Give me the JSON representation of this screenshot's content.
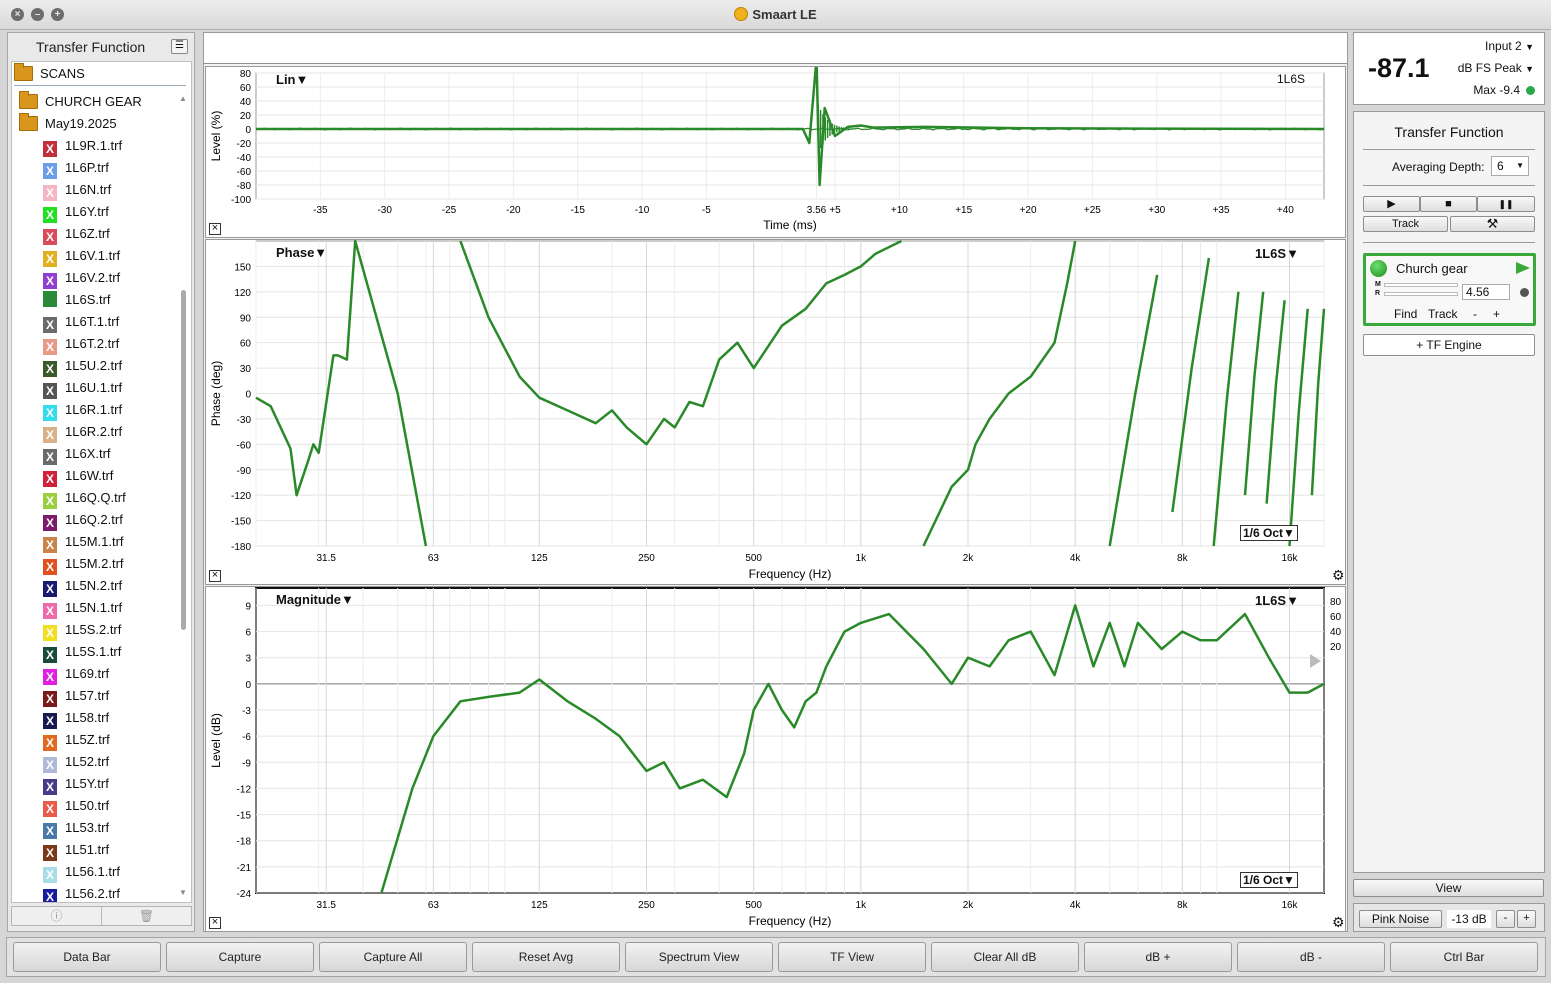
{
  "window": {
    "title": "Smaart LE"
  },
  "left_panel": {
    "title": "Transfer Function",
    "scans_label": "SCANS",
    "folders": [
      "CHURCH GEAR",
      "May19.2025"
    ],
    "files": [
      {
        "name": "1L9R.1.trf",
        "color": "#c0303a"
      },
      {
        "name": "1L6P.trf",
        "color": "#6a9ee8"
      },
      {
        "name": "1L6N.trf",
        "color": "#f4b6c4"
      },
      {
        "name": "1L6Y.trf",
        "color": "#22e022"
      },
      {
        "name": "1L6Z.trf",
        "color": "#d94a5a"
      },
      {
        "name": "1L6V.1.trf",
        "color": "#e0b020"
      },
      {
        "name": "1L6V.2.trf",
        "color": "#9040d0"
      },
      {
        "name": "1L6S.trf",
        "color": "#2a8a3a"
      },
      {
        "name": "1L6T.1.trf",
        "color": "#6a6a6a"
      },
      {
        "name": "1L6T.2.trf",
        "color": "#e89a88"
      },
      {
        "name": "1L5U.2.trf",
        "color": "#3a5a2a"
      },
      {
        "name": "1L6U.1.trf",
        "color": "#555555"
      },
      {
        "name": "1L6R.1.trf",
        "color": "#33ddee"
      },
      {
        "name": "1L6R.2.trf",
        "color": "#d8b08a"
      },
      {
        "name": "1L6X.trf",
        "color": "#6a6a6a"
      },
      {
        "name": "1L6W.trf",
        "color": "#d0203a"
      },
      {
        "name": "1L6Q.Q.trf",
        "color": "#9ad040"
      },
      {
        "name": "1L6Q.2.trf",
        "color": "#7a1a6a"
      },
      {
        "name": "1L5M.1.trf",
        "color": "#c8844a"
      },
      {
        "name": "1L5M.2.trf",
        "color": "#e05020"
      },
      {
        "name": "1L5N.2.trf",
        "color": "#1a1a70"
      },
      {
        "name": "1L5N.1.trf",
        "color": "#ee6aa8"
      },
      {
        "name": "1L5S.2.trf",
        "color": "#f0e020"
      },
      {
        "name": "1L5S.1.trf",
        "color": "#1a4a3a"
      },
      {
        "name": "1L69.trf",
        "color": "#e020e0"
      },
      {
        "name": "1L57.trf",
        "color": "#7a1a1a"
      },
      {
        "name": "1L58.trf",
        "color": "#1a1a50"
      },
      {
        "name": "1L5Z.trf",
        "color": "#e06a20"
      },
      {
        "name": "1L52.trf",
        "color": "#b0b8d8"
      },
      {
        "name": "1L5Y.trf",
        "color": "#4a3a8a"
      },
      {
        "name": "1L50.trf",
        "color": "#e85a4a"
      },
      {
        "name": "1L53.trf",
        "color": "#4a78a8"
      },
      {
        "name": "1L51.trf",
        "color": "#7a3a1a"
      },
      {
        "name": "1L56.1.trf",
        "color": "#a8dde8"
      },
      {
        "name": "1L56.2.trf",
        "color": "#1a1aa0"
      }
    ]
  },
  "impulse_plot": {
    "mode_label": "Lin▼",
    "trace_label": "1L6S",
    "ylabel": "Level (%)",
    "xlabel": "Time (ms)",
    "yticks": [
      "80",
      "60",
      "40",
      "20",
      "0",
      "-20",
      "-40",
      "-60",
      "-80",
      "-100"
    ],
    "xticks": [
      "-35",
      "-30",
      "-25",
      "-20",
      "-15",
      "-10",
      "-5",
      "3.56",
      "+5",
      "+10",
      "+15",
      "+20",
      "+25",
      "+30",
      "+35",
      "+40"
    ]
  },
  "phase_plot": {
    "mode_label": "Phase▼",
    "trace_label": "1L6S▼",
    "smoothing": "1/6 Oct▼",
    "ylabel": "Phase (deg)",
    "xlabel": "Frequency (Hz)",
    "yticks": [
      "150",
      "120",
      "90",
      "60",
      "30",
      "0",
      "-30",
      "-60",
      "-90",
      "-120",
      "-150",
      "-180"
    ],
    "xticks": [
      "31.5",
      "63",
      "125",
      "250",
      "500",
      "1k",
      "2k",
      "4k",
      "8k",
      "16k"
    ]
  },
  "magnitude_plot": {
    "mode_label": "Magnitude▼",
    "trace_label": "1L6S▼",
    "smoothing": "1/6 Oct▼",
    "ylabel": "Level (dB)",
    "xlabel": "Frequency (Hz)",
    "yticks": [
      "9",
      "6",
      "3",
      "0",
      "-3",
      "-6",
      "-9",
      "-12",
      "-15",
      "-18",
      "-21",
      "-24"
    ],
    "coherence_ticks": [
      "80",
      "60",
      "40",
      "20"
    ],
    "xticks": [
      "31.5",
      "63",
      "125",
      "250",
      "500",
      "1k",
      "2k",
      "4k",
      "8k",
      "16k"
    ]
  },
  "meter": {
    "value": "-87.1",
    "input": "Input 2",
    "unit": "dB FS Peak",
    "max": "Max -9.4"
  },
  "tf_panel": {
    "title": "Transfer Function",
    "averaging_label": "Averaging Depth:",
    "averaging_value": "6",
    "play_icon": "▶",
    "stop_icon": "■",
    "pause_icon": "❚❚",
    "track_label": "Track",
    "tools_icon": "⚒",
    "engine": {
      "name": "Church gear",
      "delay": "4.56",
      "m_label": "M",
      "r_label": "R",
      "find": "Find",
      "track": "Track",
      "minus": "-",
      "plus": "+"
    },
    "add_engine": "+ TF Engine",
    "view_label": "View",
    "pink_noise": "Pink Noise",
    "noise_level": "-13 dB",
    "noise_minus": "-",
    "noise_plus": "+"
  },
  "bottom_bar": {
    "buttons": [
      "Data Bar",
      "Capture",
      "Capture All",
      "Reset Avg",
      "Spectrum View",
      "TF View",
      "Clear All dB",
      "dB +",
      "dB -",
      "Ctrl Bar"
    ]
  },
  "colors": {
    "trace": "#2a8a2a",
    "accent": "#3aa83a"
  },
  "chart_data": [
    {
      "type": "line",
      "title": "Lin",
      "xlabel": "Time (ms)",
      "ylabel": "Level (%)",
      "ylim": [
        -100,
        80
      ],
      "xlim": [
        -40,
        43
      ],
      "series": [
        {
          "name": "1L6S",
          "x": [
            -40,
            2.5,
            3.0,
            3.56,
            3.8,
            4.2,
            5,
            6,
            7,
            8,
            12,
            20,
            43
          ],
          "y": [
            0,
            0,
            -20,
            100,
            -80,
            30,
            -10,
            3,
            5,
            2,
            3,
            1,
            0
          ]
        }
      ]
    },
    {
      "type": "line",
      "title": "Phase",
      "xlabel": "Frequency (Hz)",
      "ylabel": "Phase (deg)",
      "ylim": [
        -180,
        180
      ],
      "grid": true,
      "series": [
        {
          "name": "1L6S",
          "x": [
            20,
            22,
            25,
            26,
            28,
            29,
            30,
            33,
            34,
            36,
            38,
            50,
            60,
            75,
            90,
            110,
            125,
            150,
            180,
            200,
            220,
            250,
            280,
            300,
            330,
            360,
            400,
            450,
            500,
            600,
            700,
            800,
            900,
            1000,
            1100,
            1300,
            1500,
            1800,
            2000,
            2100,
            2300,
            2600,
            3000,
            3500,
            3800,
            4000
          ],
          "y": [
            -5,
            -15,
            -65,
            -120,
            -80,
            -60,
            -70,
            45,
            45,
            40,
            180,
            0,
            -180,
            180,
            90,
            20,
            -5,
            -20,
            -35,
            -20,
            -40,
            -60,
            -30,
            -40,
            -10,
            -15,
            40,
            60,
            30,
            80,
            100,
            130,
            140,
            150,
            165,
            180,
            -180,
            -110,
            -90,
            -60,
            -30,
            0,
            20,
            60,
            130,
            180
          ]
        }
      ]
    },
    {
      "type": "line",
      "title": "Magnitude",
      "xlabel": "Frequency (Hz)",
      "ylabel": "Level (dB)",
      "ylim": [
        -24,
        11
      ],
      "grid": true,
      "series": [
        {
          "name": "1L6S",
          "x": [
            45,
            55,
            63,
            75,
            90,
            110,
            125,
            150,
            180,
            210,
            250,
            280,
            310,
            360,
            420,
            470,
            500,
            550,
            600,
            650,
            700,
            750,
            800,
            900,
            1000,
            1200,
            1500,
            1800,
            2000,
            2300,
            2600,
            3000,
            3500,
            4000,
            4500,
            5000,
            5500,
            6000,
            7000,
            8000,
            9000,
            10000,
            12000,
            14000,
            16000,
            18000,
            20000
          ],
          "y": [
            -24,
            -12,
            -6,
            -2,
            -1.5,
            -1,
            0.5,
            -2,
            -4,
            -6,
            -10,
            -9,
            -12,
            -11,
            -13,
            -8,
            -3,
            0,
            -3,
            -5,
            -2,
            -1,
            2,
            6,
            7,
            8,
            4,
            0,
            3,
            2,
            5,
            6,
            1,
            9,
            2,
            7,
            2,
            7,
            4,
            6,
            5,
            5,
            8,
            3,
            -1,
            -1,
            0
          ]
        }
      ]
    }
  ]
}
